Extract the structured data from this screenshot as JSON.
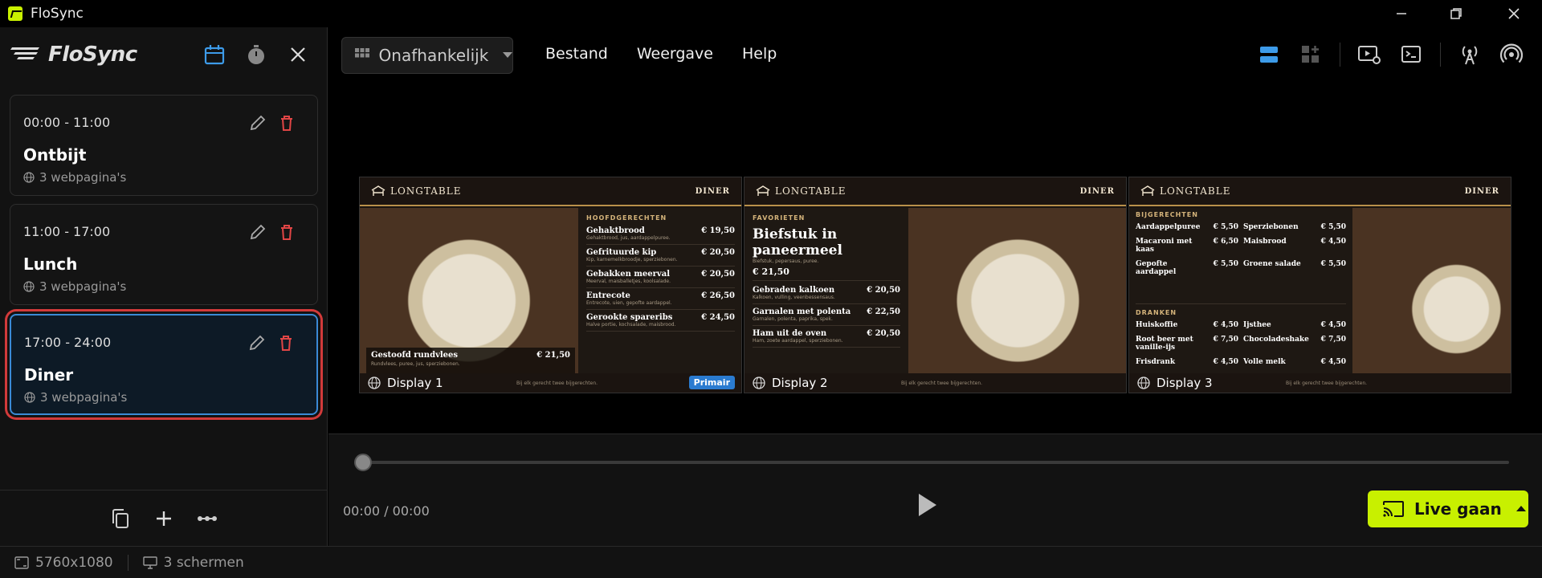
{
  "window": {
    "title": "FloSync"
  },
  "sidebar": {
    "logo_text": "FloSync",
    "slots": [
      {
        "time": "00:00 - 11:00",
        "name": "Ontbijt",
        "pages": "3 webpagina's",
        "active": false
      },
      {
        "time": "11:00 - 17:00",
        "name": "Lunch",
        "pages": "3 webpagina's",
        "active": false
      },
      {
        "time": "17:00 - 24:00",
        "name": "Diner",
        "pages": "3 webpagina's",
        "active": true
      }
    ]
  },
  "toolbar": {
    "layout_label": "Onafhankelijk",
    "menu": [
      "Bestand",
      "Weergave",
      "Help"
    ]
  },
  "displays": [
    {
      "label": "Display 1",
      "badge": "Primair",
      "brand": "LONGTABLE",
      "tag": "DINER",
      "section": "HOOFDGERECHTEN",
      "feature": {
        "name": "Gestoofd rundvlees",
        "price": "€ 21,50",
        "desc": "Rundvlees, puree, jus, sperziebonen."
      },
      "items": [
        {
          "name": "Gehaktbrood",
          "price": "€ 19,50",
          "desc": "Gehaktbrood, jus, aardappelpuree."
        },
        {
          "name": "Gefrituurde kip",
          "price": "€ 20,50",
          "desc": "Kip, karnemelkbroodje, sperziebonen."
        },
        {
          "name": "Gebakken meerval",
          "price": "€ 20,50",
          "desc": "Meerval, maisballetjes, koolsalade."
        },
        {
          "name": "Entrecote",
          "price": "€ 26,50",
          "desc": "Entrecote, uien, gepofte aardappel."
        },
        {
          "name": "Gerookte spareribs",
          "price": "€ 24,50",
          "desc": "Halve portie, kochsalade, maisbrood."
        }
      ],
      "note": "Bij elk gerecht twee bijgerechten."
    },
    {
      "label": "Display 2",
      "brand": "LONGTABLE",
      "tag": "DINER",
      "section": "FAVORIETEN",
      "hero": {
        "name": "Biefstuk in paneermeel",
        "desc": "Biefstuk, pepersaus, puree.",
        "price": "€ 21,50"
      },
      "items": [
        {
          "name": "Gebraden kalkoen",
          "price": "€ 20,50",
          "desc": "Kalkoen, vulling, veenbessensaus."
        },
        {
          "name": "Garnalen met polenta",
          "price": "€ 22,50",
          "desc": "Garnalen, polenta, paprika, spek."
        },
        {
          "name": "Ham uit de oven",
          "price": "€ 20,50",
          "desc": "Ham, zoete aardappel, sperziebonen."
        }
      ],
      "note": "Bij elk gerecht twee bijgerechten."
    },
    {
      "label": "Display 3",
      "brand": "LONGTABLE",
      "tag": "DINER",
      "sides_title": "BIJGERECHTEN",
      "sides": [
        [
          "Aardappelpuree",
          "€ 5,50",
          "Sperziebonen",
          "€ 5,50"
        ],
        [
          "Macaroni met kaas",
          "€ 6,50",
          "Maisbrood",
          "€ 4,50"
        ],
        [
          "Gepofte aardappel",
          "€ 5,50",
          "Groene salade",
          "€ 5,50"
        ]
      ],
      "drinks_title": "DRANKEN",
      "drinks": [
        [
          "Huiskoffie",
          "€ 4,50",
          "Ijsthee",
          "€ 4,50"
        ],
        [
          "Root beer met vanille-ijs",
          "€ 7,50",
          "Chocoladeshake",
          "€ 7,50"
        ],
        [
          "Frisdrank",
          "€ 4,50",
          "Volle melk",
          "€ 4,50"
        ]
      ],
      "note": "Bij elk gerecht twee bijgerechten."
    }
  ],
  "player": {
    "timecode": "00:00 / 00:00",
    "live_label": "Live gaan",
    "progress": 0
  },
  "status": {
    "resolution": "5760x1080",
    "screens": "3 schermen"
  },
  "colors": {
    "accent": "#c8f000",
    "primary_blue": "#2a7bd0",
    "danger": "#e04545",
    "active_border": "#3a8ad6",
    "highlight": "#d23a3a"
  }
}
